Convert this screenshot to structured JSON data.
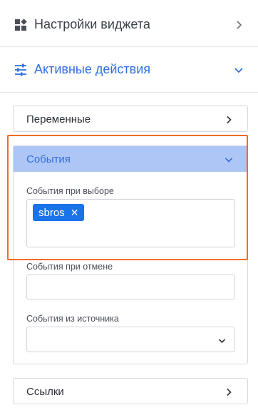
{
  "sections": {
    "widget_settings": {
      "label": "Настройки виджета",
      "icon": "widgets-icon"
    },
    "active_actions": {
      "label": "Активные действия",
      "icon": "sliders-icon"
    }
  },
  "cards": {
    "variables": {
      "label": "Переменные"
    },
    "events": {
      "label": "События",
      "fields": {
        "on_select": {
          "label": "События при выборе",
          "tags": [
            "sbros"
          ]
        },
        "on_cancel": {
          "label": "События при отмене",
          "value": ""
        },
        "from_source": {
          "label": "События из источника",
          "value": ""
        }
      }
    },
    "links": {
      "label": "Ссылки"
    }
  },
  "colors": {
    "accent": "#2f6fe0",
    "tag_bg": "#1a73e8",
    "events_header_bg": "#aec6f5",
    "highlight_border": "#f26b22"
  }
}
